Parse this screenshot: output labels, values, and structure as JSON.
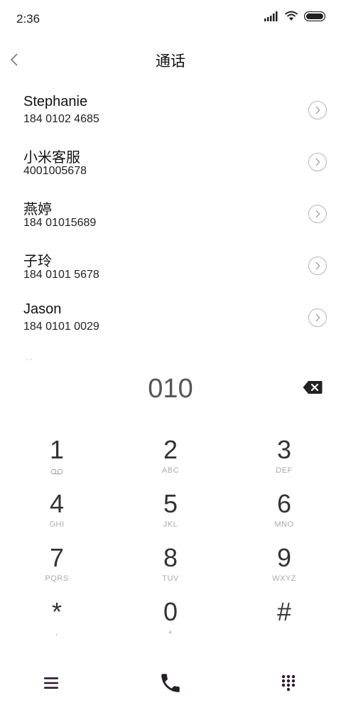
{
  "status_bar": {
    "time": "2:36"
  },
  "header": {
    "title": "通话"
  },
  "contacts": [
    {
      "name": "Stephanie",
      "number": "184 0102 4685"
    },
    {
      "name": "小米客服",
      "number": "4001005678"
    },
    {
      "name": "燕婷",
      "number": "184 01015689"
    },
    {
      "name": "子玲",
      "number": "184 0101 5678"
    },
    {
      "name": "Jason",
      "number": "184 0101 0029"
    }
  ],
  "more_indicator": "··",
  "dialer": {
    "input": "010"
  },
  "keypad": [
    {
      "digit": "1",
      "letters": ""
    },
    {
      "digit": "2",
      "letters": "ABC"
    },
    {
      "digit": "3",
      "letters": "DEF"
    },
    {
      "digit": "4",
      "letters": "GHI"
    },
    {
      "digit": "5",
      "letters": "JKL"
    },
    {
      "digit": "6",
      "letters": "MNO"
    },
    {
      "digit": "7",
      "letters": "PQRS"
    },
    {
      "digit": "8",
      "letters": "TUV"
    },
    {
      "digit": "9",
      "letters": "WXYZ"
    },
    {
      "digit": "*",
      "letters": ","
    },
    {
      "digit": "0",
      "letters": "+"
    },
    {
      "digit": "#",
      "letters": ""
    }
  ],
  "icons": {
    "back": "chevron-left-icon",
    "detail": "chevron-right-icon",
    "backspace": "backspace-icon",
    "voicemail": "voicemail-icon",
    "menu": "menu-icon",
    "call": "phone-icon",
    "dialpad": "dialpad-icon"
  },
  "colors": {
    "accent": "#2a1a2e",
    "text": "#111111",
    "muted": "#aaaaaa"
  }
}
